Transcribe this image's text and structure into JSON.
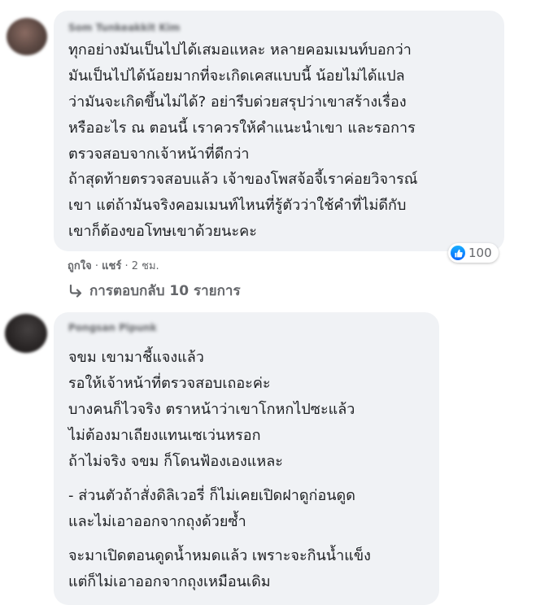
{
  "comments": [
    {
      "author": "Som Tunkeakkit Kim",
      "paragraphs": [
        "ทุกอย่างมันเป็นไปได้เสมอแหละ หลายคอมเมนท์บอกว่า\nมันเป็นไปได้น้อยมากที่จะเกิดเคสแบบนี้ น้อยไม่ได้แปล\nว่ามันจะเกิดขึ้นไม่ได้? อย่ารีบด่วยสรุปว่าเขาสร้างเรื่อง\nหรืออะไร ณ ตอนนี้ เราควรให้คำแนะนำเขา และรอการ\nตรวจสอบจากเจ้าหน้าที่ดีกว่า",
        "ถ้าสุดท้ายตรวจสอบแล้ว เจ้าของโพสจ้อจี้เราค่อยวิจารณ์\nเขา แต่ถ้ามันจริงคอมเมนท์ไหนที่รู้ตัวว่าใช้คำที่ไม่ดีกับ\nเขาก็ต้องขอโทษเขาด้วยนะคะ"
      ],
      "reaction_count": "100",
      "like_label": "ถูกใจ",
      "share_label": "แชร์",
      "separator": "·",
      "time": "2 ชม.",
      "replies_label": "การตอบกลับ 10 รายการ"
    },
    {
      "author": "Pongsan Pipunk",
      "paragraphs": [
        "จขม เขามาชี้แจงแล้ว\nรอให้เจ้าหน้าที่ตรวจสอบเถอะค่ะ\nบางคนก็ไวจริง ตราหน้าว่าเขาโกหกไปซะแล้ว",
        "ไม่ต้องมาเถียงแทนเซเว่นหรอก\nถ้าไม่จริง จขม ก็โดนฟ้องเองแหละ",
        "- ส่วนตัวถ้าสั่งดิลิเวอรี่ ก็ไม่เคยเปิดฝาดูก่อนดูด\nและไม่เอาออกจากถุงด้วยซ้ำ",
        "จะมาเปิดตอนดูดน้ำหมดแล้ว เพราะจะกินน้ำแข็ง\nแต่ก็ไม่เอาออกจากถุงเหมือนเดิม"
      ]
    }
  ],
  "colors": {
    "bubble": "#f0f2f5",
    "text": "#1c1e21",
    "meta": "#65676b",
    "like_blue": "#0866ff"
  }
}
